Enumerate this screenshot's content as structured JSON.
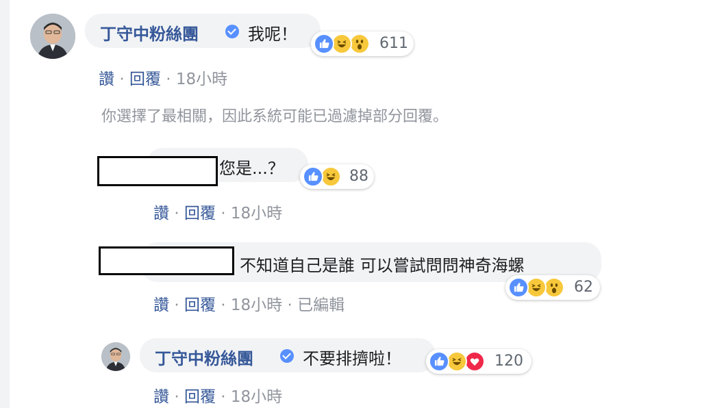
{
  "comments": [
    {
      "author": "丁守中粉絲團",
      "verified": true,
      "text": "我呢！",
      "reactions": [
        "like",
        "haha",
        "wow"
      ],
      "reaction_count": "611",
      "actions": {
        "like": "讚",
        "reply": "回覆",
        "separator": "·",
        "time": "18小時"
      }
    },
    {
      "author": "",
      "redacted_name": true,
      "text": "您是...？",
      "reactions": [
        "like",
        "haha"
      ],
      "reaction_count": "88",
      "actions": {
        "like": "讚",
        "reply": "回覆",
        "separator": "·",
        "time": "18小時"
      }
    },
    {
      "author": "",
      "redacted_name": true,
      "text": "不知道自己是誰 可以嘗試問問神奇海螺",
      "reactions": [
        "like",
        "haha",
        "wow"
      ],
      "reaction_count": "62",
      "actions": {
        "like": "讚",
        "reply": "回覆",
        "separator": "·",
        "time": "18小時",
        "edited": "已編輯"
      }
    },
    {
      "author": "丁守中粉絲團",
      "verified": true,
      "text": "不要排擠啦！",
      "reactions": [
        "like",
        "haha",
        "love"
      ],
      "reaction_count": "120",
      "actions": {
        "like": "讚",
        "reply": "回覆",
        "separator": "·",
        "time": "18小時"
      }
    }
  ],
  "filter_notice": "你選擇了最相關，因此系統可能已過濾掉部分回覆。",
  "colors": {
    "link": "#365899",
    "bubble": "#f2f3f5",
    "meta": "#90949c",
    "like": "#5890ff",
    "haha": "#f7c83b",
    "love": "#f0284a"
  }
}
